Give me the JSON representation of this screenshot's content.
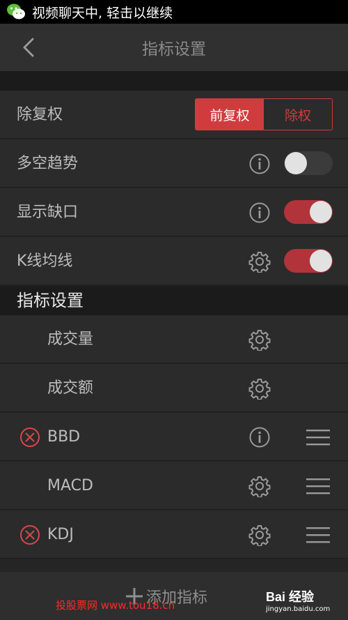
{
  "status": {
    "message": "视频聊天中, 轻击以继续"
  },
  "header": {
    "title": "指标设置"
  },
  "settings": {
    "fuquan": {
      "label": "除复权",
      "options": [
        "前复权",
        "除权"
      ],
      "selected": "前复权"
    },
    "duokong": {
      "label": "多空趋势",
      "icon": "info-icon",
      "enabled": false
    },
    "quekou": {
      "label": "显示缺口",
      "icon": "info-icon",
      "enabled": true
    },
    "kline": {
      "label": "K线均线",
      "icon": "gear-icon",
      "enabled": true
    }
  },
  "section": {
    "title": "指标设置"
  },
  "indicators": [
    {
      "name": "成交量",
      "removable": false,
      "icon": "gear-icon",
      "draggable": false
    },
    {
      "name": "成交额",
      "removable": false,
      "icon": "gear-icon",
      "draggable": false
    },
    {
      "name": "BBD",
      "removable": true,
      "icon": "info-icon",
      "draggable": true
    },
    {
      "name": "MACD",
      "removable": false,
      "icon": "gear-icon",
      "draggable": true
    },
    {
      "name": "KDJ",
      "removable": true,
      "icon": "gear-icon",
      "draggable": true
    }
  ],
  "footer": {
    "add_label": "添加指标"
  },
  "watermarks": {
    "left": "投股票网 www.tou18.cn",
    "brand": "Bai 经验",
    "brand_url": "jingyan.baidu.com"
  },
  "colors": {
    "accent": "#d03c3e",
    "toggle_on": "#b1343a",
    "background": "#252525"
  }
}
